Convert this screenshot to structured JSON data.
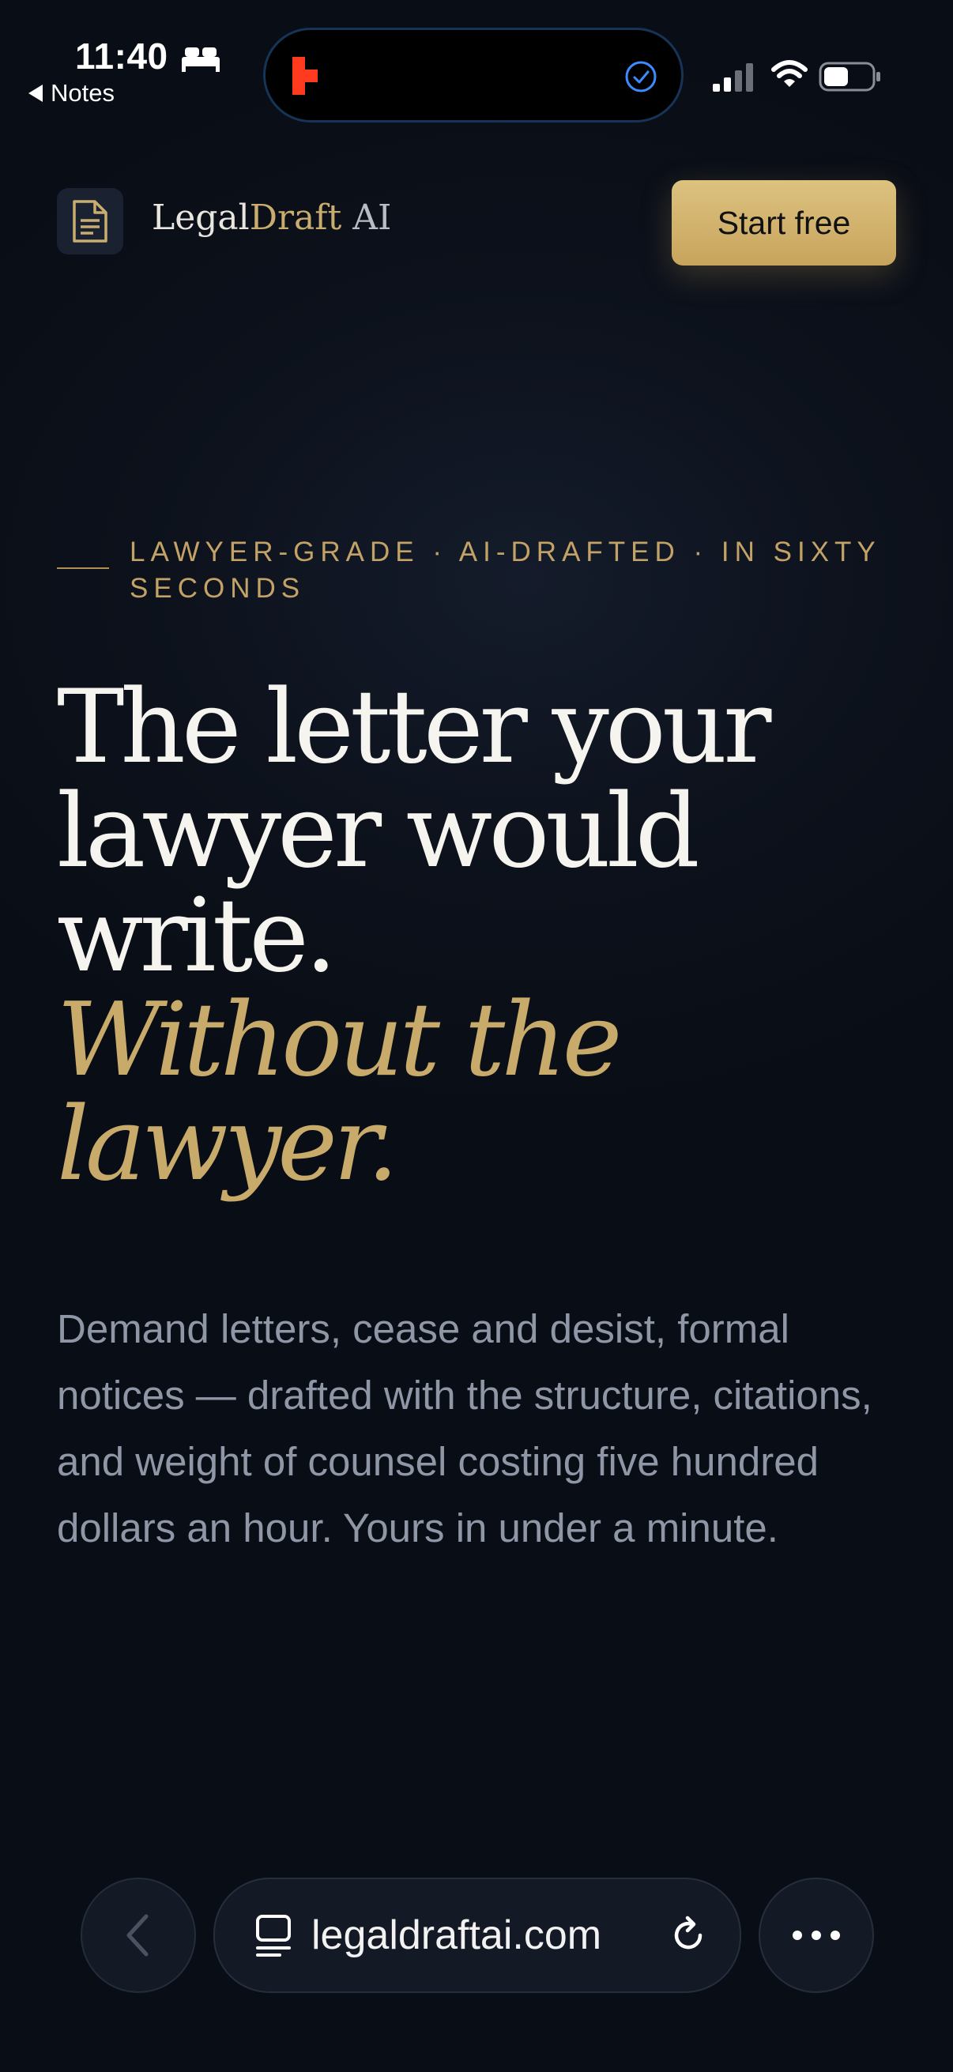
{
  "status_bar": {
    "time": "11:40",
    "back_label": "Notes"
  },
  "header": {
    "brand_part1": "Legal",
    "brand_part2": "Draft",
    "brand_part3": " AI",
    "cta_label": "Start free"
  },
  "hero": {
    "eyebrow": "LAWYER-GRADE · AI-DRAFTED · IN SIXTY SECONDS",
    "headline_lines": [
      "The letter your",
      "lawyer would",
      "write."
    ],
    "headline_italic_lines": [
      "Without the",
      "lawyer."
    ],
    "lead": "Demand letters, cease and desist, formal notices — drafted with the structure, citations, and weight of counsel costing five hundred dollars an hour. Yours in under a minute."
  },
  "browser": {
    "url": "legaldraftai.com"
  },
  "colors": {
    "background": "#0c111b",
    "accent_gold": "#c8aa6a",
    "button_gold": "#d4b46c",
    "body_text": "#8f97a6"
  },
  "icons": [
    "bed-icon",
    "app-icon",
    "check-circle-icon",
    "signal-icon",
    "wifi-icon",
    "battery-icon",
    "document-icon",
    "chevron-left-icon",
    "tabs-icon",
    "reload-icon",
    "more-icon"
  ]
}
